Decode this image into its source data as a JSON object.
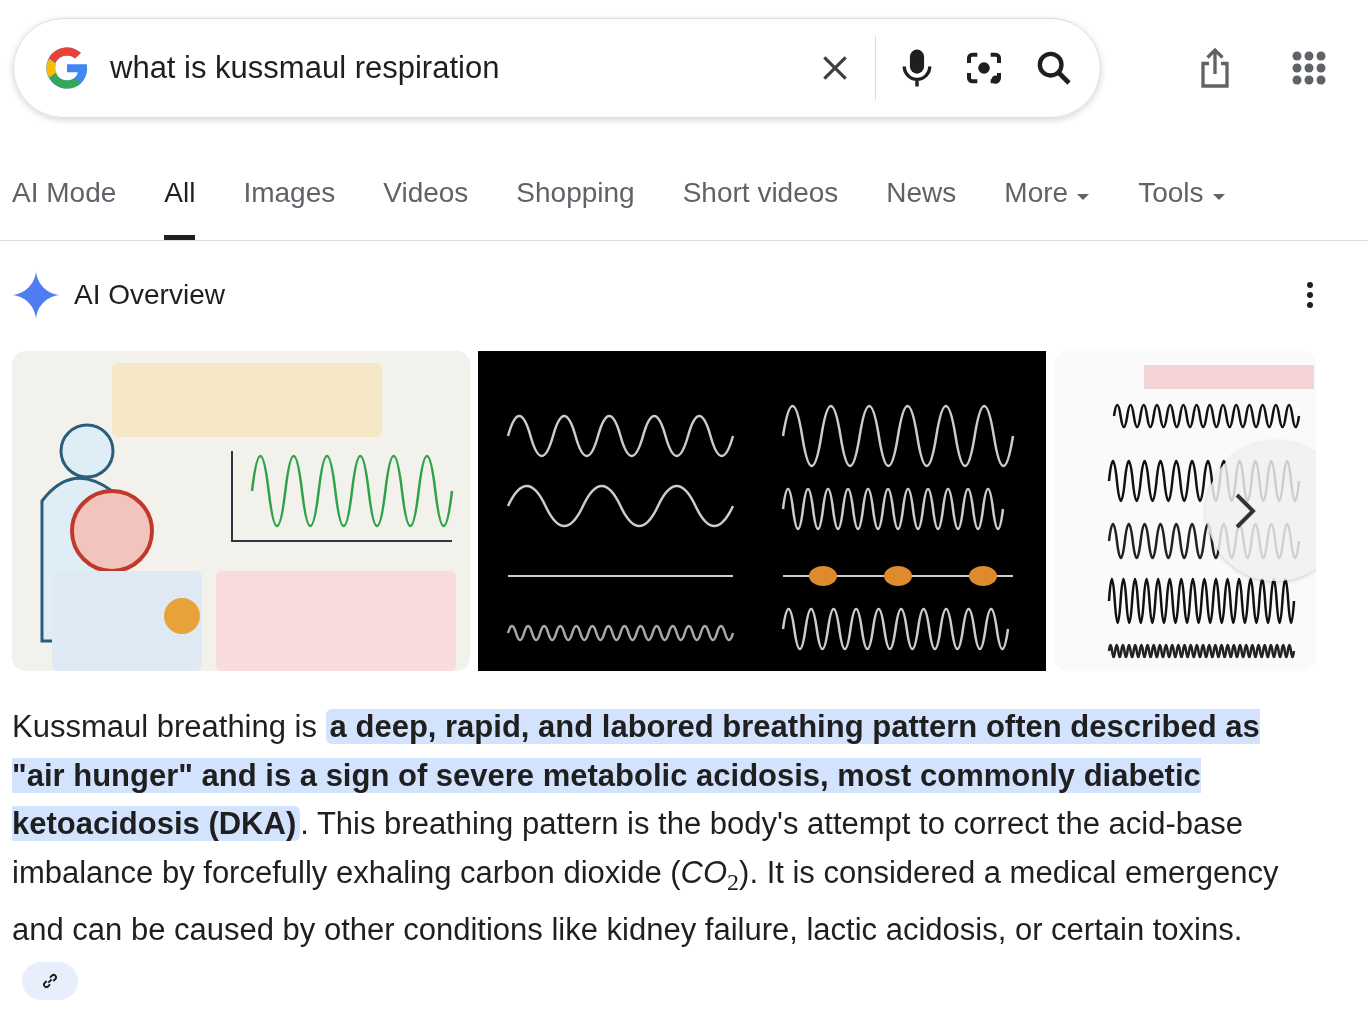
{
  "search": {
    "value": "what is kussmaul respiration"
  },
  "tabs": [
    {
      "label": "AI Mode",
      "selected": false,
      "kind": "link"
    },
    {
      "label": "All",
      "selected": true,
      "kind": "link"
    },
    {
      "label": "Images",
      "selected": false,
      "kind": "link"
    },
    {
      "label": "Videos",
      "selected": false,
      "kind": "link"
    },
    {
      "label": "Shopping",
      "selected": false,
      "kind": "link"
    },
    {
      "label": "Short videos",
      "selected": false,
      "kind": "link"
    },
    {
      "label": "News",
      "selected": false,
      "kind": "link"
    },
    {
      "label": "More",
      "selected": false,
      "kind": "menu"
    },
    {
      "label": "Tools",
      "selected": false,
      "kind": "menu"
    }
  ],
  "overview": {
    "title": "AI Overview",
    "answer": "Kussmaul breathing is **a deep, rapid, and labored breathing pattern often described as \"air hunger\" and is a sign of severe metabolic acidosis, most commonly diabetic ketoacidosis (DKA)**. This breathing pattern is the body's attempt to correct the acid-base imbalance by forcefully exhaling carbon dioxide (*CO*$_{2}$). It is considered a medical emergency and can be caused by other conditions like kidney failure, lactic acidosis, or certain toxins."
  }
}
